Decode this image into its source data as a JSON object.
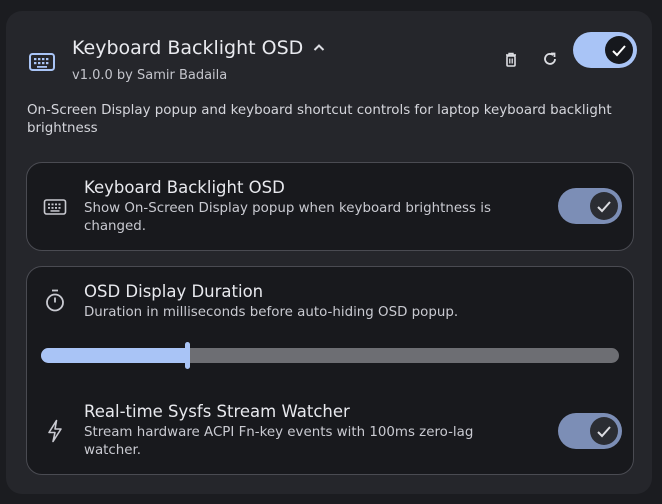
{
  "extension": {
    "title": "Keyboard Backlight OSD",
    "version": "v1.0.0 by Samir Badaila",
    "description": "On-Screen Display popup and keyboard shortcut controls for laptop keyboard backlight brightness",
    "enabled": true,
    "icons": {
      "app": "keyboard-icon",
      "expand": "chevron-up-icon",
      "delete": "trash-icon",
      "reload": "refresh-icon"
    }
  },
  "settings": {
    "osd_toggle": {
      "title": "Keyboard Backlight OSD",
      "subtitle": "Show On-Screen Display popup when keyboard brightness is changed.",
      "icon": "keyboard-icon",
      "enabled": true
    },
    "duration": {
      "title": "OSD Display Duration",
      "subtitle": "Duration in milliseconds before auto-hiding OSD popup.",
      "icon": "timer-icon",
      "slider_fraction": 0.253
    },
    "watcher": {
      "title": "Real-time Sysfs Stream Watcher",
      "subtitle": "Stream hardware ACPI Fn-key events with 100ms zero-lag watcher.",
      "icon": "bolt-icon",
      "enabled": true
    }
  },
  "colors": {
    "accent": "#a9c4f6",
    "accent_muted": "#7c8eb6",
    "card": "#25262b",
    "panel": "#18191d"
  }
}
